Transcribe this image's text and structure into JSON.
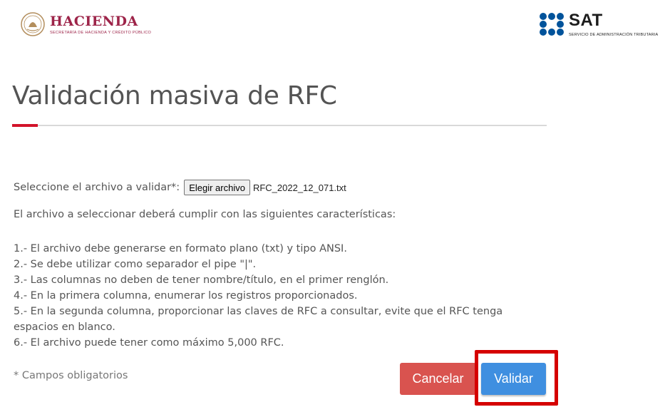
{
  "header": {
    "hacienda_title": "HACIENDA",
    "hacienda_subtitle": "SECRETARÍA DE HACIENDA Y CRÉDITO PÚBLICO",
    "sat_title": "SAT",
    "sat_subtitle": "SERVICIO DE ADMINISTRACIÓN TRIBUTARIA",
    "hacienda_icon": "mexican-seal-icon",
    "sat_icon": "sat-dots-icon"
  },
  "page": {
    "title": "Validación masiva de RFC"
  },
  "file_select": {
    "label": "Seleccione el archivo a validar*:",
    "button_label": "Elegir archivo",
    "file_name": "RFC_2022_12_071.txt"
  },
  "instructions": {
    "intro": "El archivo a seleccionar deberá cumplir con las siguientes características:",
    "rules": [
      "1.- El archivo debe generarse en formato plano (txt) y tipo ANSI.",
      "2.- Se debe utilizar como separador el pipe \"|\".",
      "3.- Las columnas no deben de tener nombre/título, en el primer renglón.",
      "4.- En la primera columna, enumerar los registros proporcionados.",
      "5.- En la segunda columna, proporcionar las claves de RFC a consultar, evite que el RFC tenga espacios en blanco.",
      "6.- El archivo puede tener como máximo 5,000 RFC."
    ]
  },
  "footer": {
    "required_note": "* Campos obligatorios",
    "cancel_label": "Cancelar",
    "validate_label": "Validar"
  },
  "colors": {
    "brand_maroon": "#9d2449",
    "accent_red": "#d2132a",
    "cancel_red": "#d9534f",
    "validate_blue": "#3f8fe0",
    "highlight_red": "#d50000"
  }
}
